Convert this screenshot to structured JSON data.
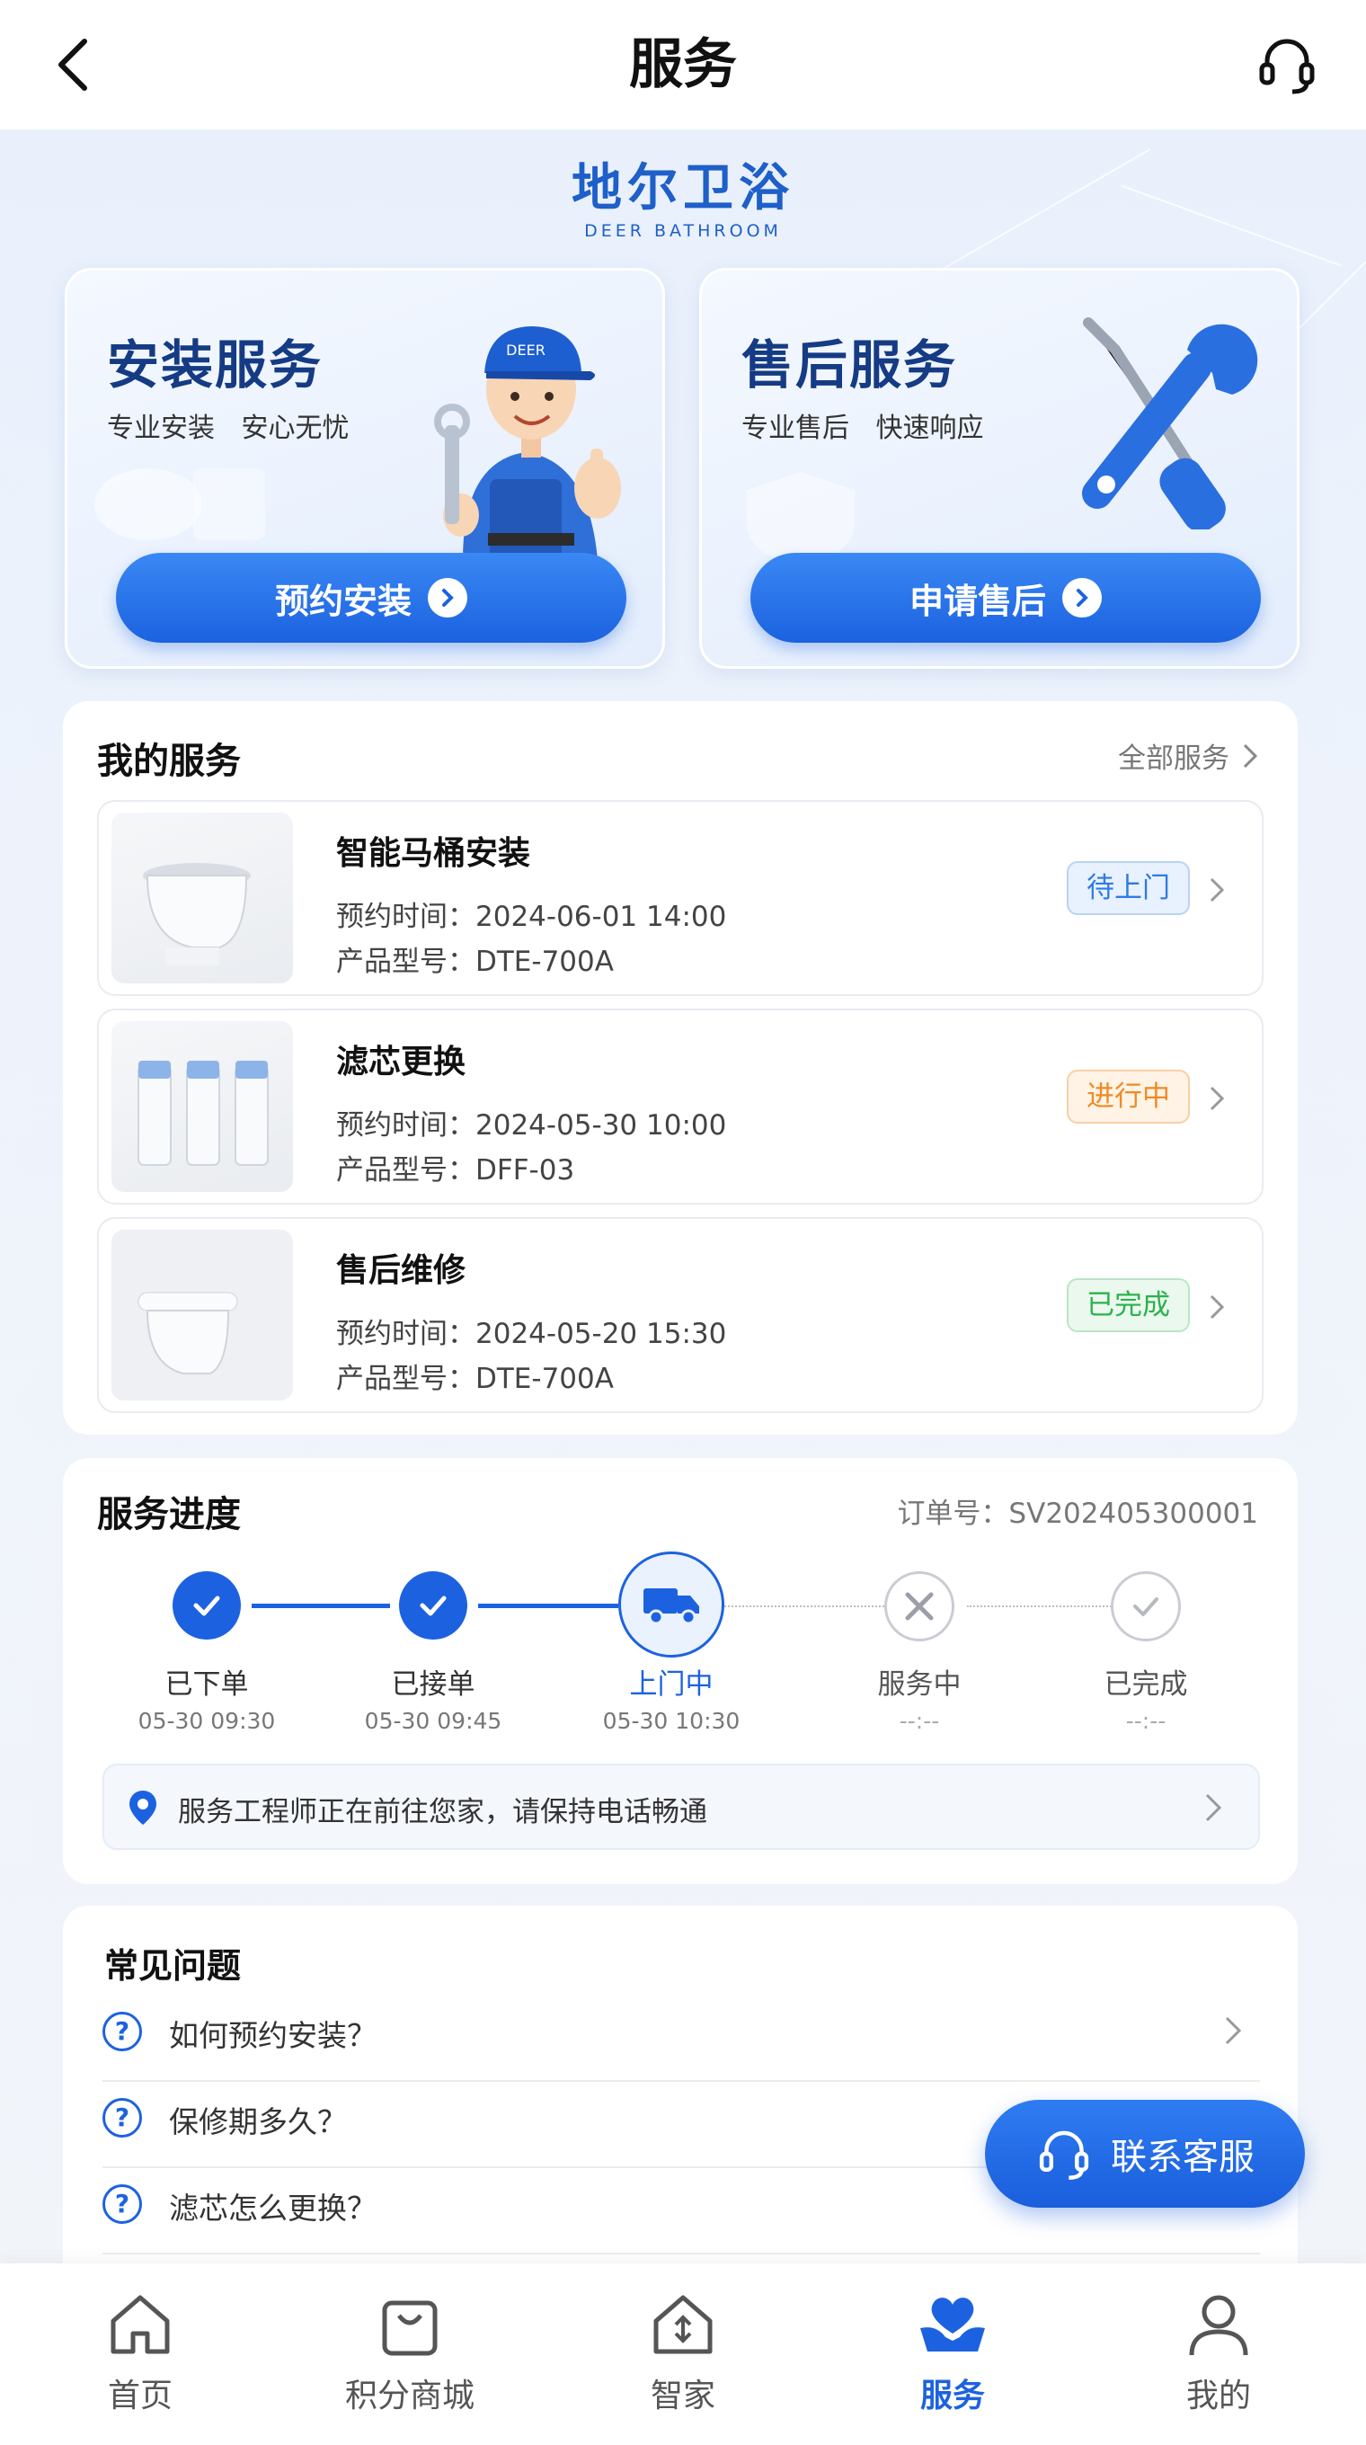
{
  "header": {
    "title": "服务"
  },
  "brand": {
    "name_cn": "地尔卫浴",
    "name_en": "DEER BATHROOM"
  },
  "install_card": {
    "title": "安装服务",
    "subtitle": "专业安装 安心无忧",
    "button": "预约安装",
    "cap_text": "DEER"
  },
  "aftersale_card": {
    "title": "售后服务",
    "subtitle": "专业售后 快速响应",
    "button": "申请售后"
  },
  "my_services": {
    "title": "我的服务",
    "all_link": "全部服务",
    "items": [
      {
        "name": "智能马桶安装",
        "time": "预约时间：2024-06-01 14:00",
        "model": "产品型号：DTE-700A",
        "status": "待上门",
        "status_color": "#2f7ae5"
      },
      {
        "name": "滤芯更换",
        "time": "预约时间：2024-05-30 10:00",
        "model": "产品型号：DFF-03",
        "status": "进行中",
        "status_color": "#f08a24"
      },
      {
        "name": "售后维修",
        "time": "预约时间：2024-05-20 15:30",
        "model": "产品型号：DTE-700A",
        "status": "已完成",
        "status_color": "#2bb24c"
      }
    ]
  },
  "progress": {
    "title": "服务进度",
    "order_no": "订单号：SV202405300001",
    "steps": [
      {
        "label": "已下单",
        "time": "05-30 09:30",
        "state": "done"
      },
      {
        "label": "已接单",
        "time": "05-30 09:45",
        "state": "done"
      },
      {
        "label": "上门中",
        "time": "05-30 10:30",
        "state": "current"
      },
      {
        "label": "服务中",
        "time": "--:--",
        "state": "pending"
      },
      {
        "label": "已完成",
        "time": "--:--",
        "state": "pending"
      }
    ],
    "notice": "服务工程师正在前往您家，请保持电话畅通"
  },
  "faq": {
    "title": "常见问题",
    "items": [
      "如何预约安装？",
      "保修期多久？",
      "滤芯怎么更换？"
    ]
  },
  "fab": {
    "label": "联系客服"
  },
  "tabbar": {
    "items": [
      {
        "label": "首页",
        "icon": "home-icon"
      },
      {
        "label": "积分商城",
        "icon": "shopping-bag-icon"
      },
      {
        "label": "智家",
        "icon": "smart-home-icon"
      },
      {
        "label": "服务",
        "icon": "heart-hand-icon",
        "active": true
      },
      {
        "label": "我的",
        "icon": "user-icon"
      }
    ]
  },
  "colors": {
    "primary": "#1c62e0",
    "brand": "#1e5fc9"
  }
}
